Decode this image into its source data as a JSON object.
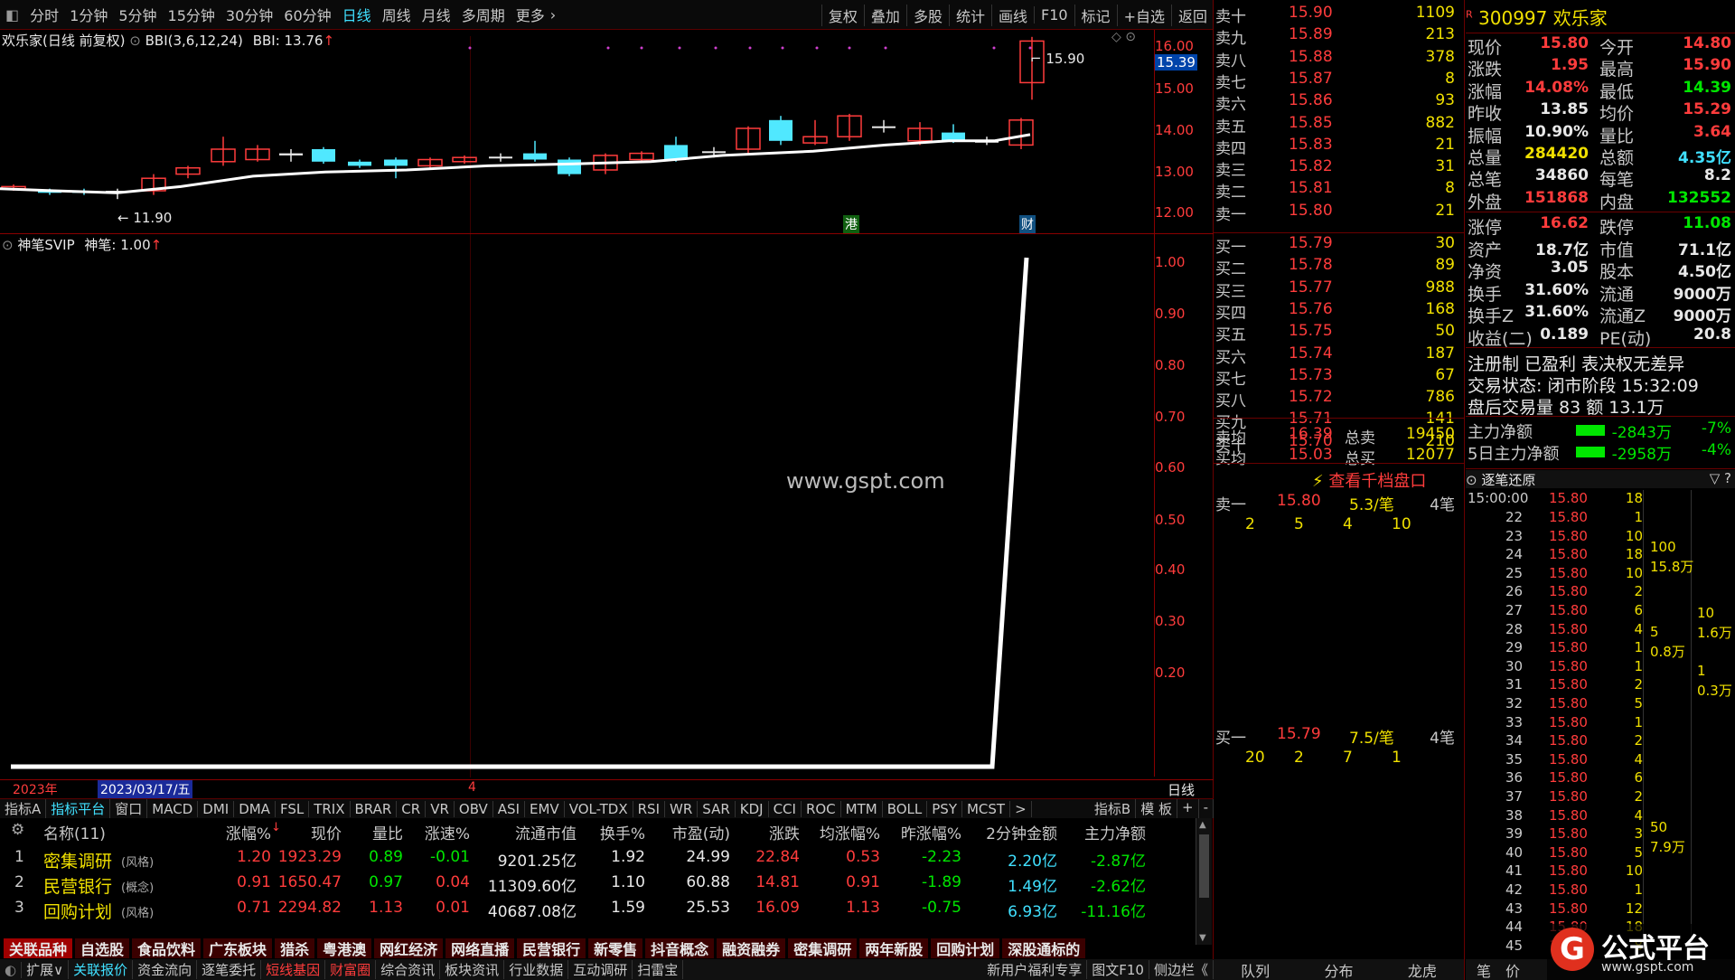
{
  "menu": {
    "items": [
      "分时",
      "1分钟",
      "5分钟",
      "15分钟",
      "30分钟",
      "60分钟",
      "日线",
      "周线",
      "月线",
      "多周期",
      "更多"
    ],
    "right": [
      "复权",
      "叠加",
      "多股",
      "统计",
      "画线",
      "F10",
      "标记",
      "+自选",
      "返回"
    ]
  },
  "kchart": {
    "title": "欢乐家(日线 前复权)",
    "ind": "BBI(3,6,12,24)",
    "ind_val": "BBI: 13.76",
    "yticks": [
      "16.00",
      "15.50",
      "15.00",
      "14.00",
      "13.00",
      "12.00"
    ],
    "high": "15.90",
    "low": "11.90",
    "cur_tag": "15.39",
    "mark1": "港",
    "mark2": "财"
  },
  "sub": {
    "title": "神笔SVIP",
    "val": "神笔: 1.00",
    "yticks": [
      "1.00",
      "0.90",
      "0.80",
      "0.70",
      "0.60",
      "0.50",
      "0.40",
      "0.30",
      "0.20"
    ],
    "watermark": "www.gspt.com"
  },
  "timeaxis": {
    "year": "2023年",
    "date": "2023/03/17/五",
    "tick": "4",
    "mode": "日线"
  },
  "indtabs": [
    "指标A",
    "指标平台",
    "窗口",
    "MACD",
    "DMI",
    "DMA",
    "FSL",
    "TRIX",
    "BRAR",
    "CR",
    "VR",
    "OBV",
    "ASI",
    "EMV",
    "VOL-TDX",
    "RSI",
    "WR",
    "SAR",
    "KDJ",
    "CCI",
    "ROC",
    "MTM",
    "BOLL",
    "PSY",
    "MCST"
  ],
  "indtabs_right": [
    "指标B",
    "模 板",
    "+",
    "-"
  ],
  "table": {
    "headers": [
      "名称(11)",
      "涨幅%",
      "现价",
      "量比",
      "涨速%",
      "流通市值",
      "换手%",
      "市盈(动)",
      "涨跌",
      "均涨幅%",
      "昨涨幅%",
      "2分钟金额",
      "主力净额"
    ],
    "rows": [
      {
        "n": "1",
        "name": "密集调研",
        "tag": "(风格)",
        "c": [
          "1.20",
          "1923.29",
          "0.89",
          "-0.01",
          "9201.25亿",
          "1.92",
          "24.99",
          "22.84",
          "0.53",
          "-2.23",
          "2.20亿",
          "-2.87亿"
        ]
      },
      {
        "n": "2",
        "name": "民营银行",
        "tag": "(概念)",
        "c": [
          "0.91",
          "1650.47",
          "0.97",
          "0.04",
          "11309.60亿",
          "1.10",
          "60.88",
          "14.81",
          "0.91",
          "-1.89",
          "1.49亿",
          "-2.62亿"
        ]
      },
      {
        "n": "3",
        "name": "回购计划",
        "tag": "(风格)",
        "c": [
          "0.71",
          "2294.82",
          "1.13",
          "0.01",
          "40687.08亿",
          "1.59",
          "25.53",
          "16.09",
          "1.13",
          "-0.75",
          "6.93亿",
          "-11.16亿"
        ]
      }
    ]
  },
  "btabs": [
    "关联品种",
    "自选股",
    "食品饮料",
    "广东板块",
    "猎杀",
    "粤港澳",
    "网红经济",
    "网络直播",
    "民营银行",
    "新零售",
    "抖音概念",
    "融资融券",
    "密集调研",
    "两年新股",
    "回购计划",
    "深股通标的"
  ],
  "status": [
    "扩展∨",
    "关联报价",
    "资金流向",
    "逐笔委托",
    "短线基因",
    "财富圈",
    "综合资讯",
    "板块资讯",
    "行业数据",
    "互动调研",
    "扫雷宝"
  ],
  "status_right": [
    "新用户福利专享",
    "图文F10",
    "侧边栏《"
  ],
  "orderbook": {
    "sells": [
      [
        "卖十",
        "15.90",
        "1109"
      ],
      [
        "卖九",
        "15.89",
        "213"
      ],
      [
        "卖八",
        "15.88",
        "378"
      ],
      [
        "卖七",
        "15.87",
        "8"
      ],
      [
        "卖六",
        "15.86",
        "93"
      ],
      [
        "卖五",
        "15.85",
        "882"
      ],
      [
        "卖四",
        "15.83",
        "21"
      ],
      [
        "卖三",
        "15.82",
        "31"
      ],
      [
        "卖二",
        "15.81",
        "8"
      ],
      [
        "卖一",
        "15.80",
        "21"
      ]
    ],
    "buys": [
      [
        "买一",
        "15.79",
        "30"
      ],
      [
        "买二",
        "15.78",
        "89"
      ],
      [
        "买三",
        "15.77",
        "988"
      ],
      [
        "买四",
        "15.76",
        "168"
      ],
      [
        "买五",
        "15.75",
        "50"
      ],
      [
        "买六",
        "15.74",
        "187"
      ],
      [
        "买七",
        "15.73",
        "67"
      ],
      [
        "买八",
        "15.72",
        "786"
      ],
      [
        "买九",
        "15.71",
        "141"
      ],
      [
        "买十",
        "15.70",
        "210"
      ]
    ],
    "avg_sell": [
      "卖均",
      "16.39",
      "总卖",
      "19450"
    ],
    "avg_buy": [
      "买均",
      "15.03",
      "总买",
      "12077"
    ],
    "link": "查看千档盘口",
    "s1": [
      "卖一",
      "15.80",
      "5.3/笔",
      "4笔"
    ],
    "s1q": [
      "2",
      "5",
      "4",
      "10"
    ],
    "b1": [
      "买一",
      "15.79",
      "7.5/笔",
      "4笔"
    ],
    "b1q": [
      "20",
      "2",
      "7",
      "1"
    ],
    "bottom": [
      "队列",
      "分布",
      "龙虎"
    ]
  },
  "quote": {
    "code": "300997",
    "name": "欢乐家",
    "rows": [
      [
        "现价",
        "15.80",
        "今开",
        "14.80"
      ],
      [
        "涨跌",
        "1.95",
        "最高",
        "15.90"
      ],
      [
        "涨幅",
        "14.08%",
        "最低",
        "14.39"
      ],
      [
        "昨收",
        "13.85",
        "均价",
        "15.29"
      ],
      [
        "振幅",
        "10.90%",
        "量比",
        "3.64"
      ],
      [
        "总量",
        "284420",
        "总额",
        "4.35亿"
      ],
      [
        "总笔",
        "34860",
        "每笔",
        "8.2"
      ],
      [
        "外盘",
        "151868",
        "内盘",
        "132552"
      ]
    ],
    "rows2": [
      [
        "涨停",
        "16.62",
        "跌停",
        "11.08"
      ],
      [
        "资产",
        "18.7亿",
        "市值",
        "71.1亿"
      ],
      [
        "净资",
        "3.05",
        "股本",
        "4.50亿"
      ],
      [
        "换手",
        "31.60%",
        "流通",
        "9000万"
      ],
      [
        "换手Z",
        "31.60%",
        "流通Z",
        "9000万"
      ],
      [
        "收益(二)",
        "0.189",
        "PE(动)",
        "20.8"
      ]
    ],
    "notes": [
      "注册制 已盈利 表决权无差异",
      "交易状态: 闭市阶段 15:32:09",
      "盘后交易量 83 额 13.1万"
    ],
    "flow": [
      [
        "主力净额",
        "-2843万",
        "-7%"
      ],
      [
        "5日主力净额",
        "-2958万",
        "-4%"
      ]
    ]
  },
  "ticks": {
    "title": "逐笔还原",
    "start": "15:00:00",
    "rows": [
      [
        "22",
        "15.80",
        "1"
      ],
      [
        "23",
        "15.80",
        "10"
      ],
      [
        "24",
        "15.80",
        "18"
      ],
      [
        "25",
        "15.80",
        "10"
      ],
      [
        "26",
        "15.80",
        "2"
      ],
      [
        "27",
        "15.80",
        "6"
      ],
      [
        "28",
        "15.80",
        "4"
      ],
      [
        "29",
        "15.80",
        "1"
      ],
      [
        "30",
        "15.80",
        "1"
      ],
      [
        "31",
        "15.80",
        "2"
      ],
      [
        "32",
        "15.80",
        "5"
      ],
      [
        "33",
        "15.80",
        "1"
      ],
      [
        "34",
        "15.80",
        "2"
      ],
      [
        "35",
        "15.80",
        "4"
      ],
      [
        "36",
        "15.80",
        "6"
      ],
      [
        "37",
        "15.80",
        "2"
      ],
      [
        "38",
        "15.80",
        "4"
      ],
      [
        "39",
        "15.80",
        "3"
      ],
      [
        "40",
        "15.80",
        "5"
      ],
      [
        "41",
        "15.80",
        "10"
      ],
      [
        "42",
        "15.80",
        "1"
      ],
      [
        "43",
        "15.80",
        "12"
      ],
      [
        "44",
        "15.80",
        "18"
      ],
      [
        "45",
        "15.80",
        "8"
      ]
    ],
    "first": "18",
    "blocks": [
      "100",
      "15.8万",
      "5",
      "0.8万",
      "50",
      "7.9万"
    ],
    "right": [
      "10",
      "1.6万",
      "1",
      "0.3万"
    ],
    "bottom": [
      "笔",
      "价"
    ]
  },
  "brand": {
    "name": "公式平台",
    "url": "www.gspt.com"
  }
}
